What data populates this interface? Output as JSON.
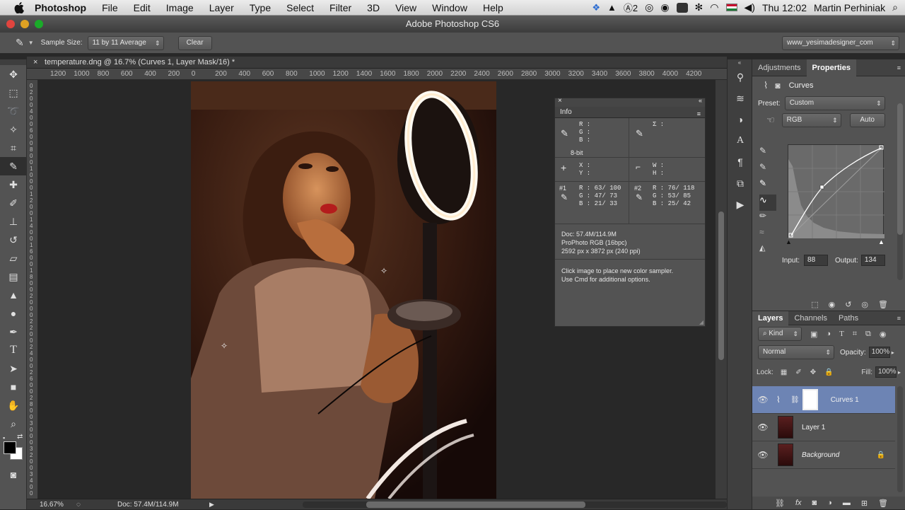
{
  "menubar": {
    "items": [
      "Photoshop",
      "File",
      "Edit",
      "Image",
      "Layer",
      "Type",
      "Select",
      "Filter",
      "3D",
      "View",
      "Window",
      "Help"
    ],
    "clock": "Thu 12:02",
    "user": "Martin Perhiniak",
    "tray_badge": "2"
  },
  "titlebar": {
    "title": "Adobe Photoshop CS6"
  },
  "options": {
    "sample_size_label": "Sample Size:",
    "sample_size_value": "11 by 11 Average",
    "clear_label": "Clear",
    "workspace": "www_yesimadesigner_com"
  },
  "document": {
    "tab_title": "temperature.dng @ 16.7% (Curves 1, Layer Mask/16) *",
    "ruler_top": [
      "1200",
      "1000",
      "800",
      "600",
      "400",
      "200",
      "0",
      "200",
      "400",
      "600",
      "800",
      "1000",
      "1200",
      "1400",
      "1600",
      "1800",
      "2000",
      "2200",
      "2400",
      "2600",
      "2800",
      "3000",
      "3200",
      "3400",
      "3600",
      "3800",
      "4000",
      "4200"
    ],
    "ruler_left": [
      "0",
      "2",
      "0",
      "0",
      "4",
      "0",
      "0",
      "6",
      "0",
      "0",
      "8",
      "0",
      "0",
      "1",
      "0",
      "0",
      "0",
      "1",
      "2",
      "0",
      "0",
      "1",
      "4",
      "0",
      "0",
      "1",
      "6",
      "0",
      "0",
      "1",
      "8",
      "0",
      "0",
      "2",
      "0",
      "0",
      "0",
      "2",
      "2",
      "0",
      "0",
      "2",
      "4",
      "0",
      "0",
      "2",
      "6",
      "0",
      "0",
      "2",
      "8",
      "0",
      "0",
      "3",
      "0",
      "0",
      "0",
      "3",
      "2",
      "0",
      "0",
      "3",
      "4",
      "0",
      "0"
    ],
    "zoom": "16.67%",
    "doc_size": "Doc: 57.4M/114.9M"
  },
  "info": {
    "tab": "Info",
    "rgb_labels": [
      "R :",
      "G :",
      "B :"
    ],
    "bit_depth": "8-bit",
    "xy_labels": [
      "X :",
      "Y :"
    ],
    "wh_labels": [
      "W :",
      "H :"
    ],
    "sigma": "Σ :",
    "sampler1": {
      "id": "#1",
      "r": "R :  63/ 100",
      "g": "G :  47/  73",
      "b": "B :  21/  33"
    },
    "sampler2": {
      "id": "#2",
      "r": "R :  76/ 118",
      "g": "G :  53/  85",
      "b": "B :  25/  42"
    },
    "doc_line": "Doc: 57.4M/114.9M",
    "profile": "ProPhoto RGB (16bpc)",
    "dims": "2592 px x 3872 px (240 ppi)",
    "hint1": "Click image to place new color sampler.",
    "hint2": "Use Cmd for additional options."
  },
  "properties": {
    "tabs": [
      "Adjustments",
      "Properties"
    ],
    "title": "Curves",
    "preset_label": "Preset:",
    "preset_value": "Custom",
    "channel": "RGB",
    "auto_label": "Auto",
    "input_label": "Input:",
    "input_value": "88",
    "output_label": "Output:",
    "output_value": "134"
  },
  "layers": {
    "tabs": [
      "Layers",
      "Channels",
      "Paths"
    ],
    "kind_label": "Kind",
    "blend_mode": "Normal",
    "opacity_label": "Opacity:",
    "opacity_value": "100%",
    "lock_label": "Lock:",
    "fill_label": "Fill:",
    "fill_value": "100%",
    "items": [
      {
        "name": "Curves 1"
      },
      {
        "name": "Layer 1"
      },
      {
        "name": "Background"
      }
    ]
  },
  "colors": {
    "accent_selected_layer": "#6d84b4",
    "panel": "#535353"
  }
}
